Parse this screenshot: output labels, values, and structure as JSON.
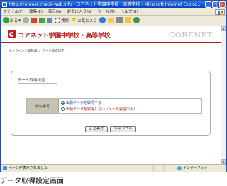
{
  "window": {
    "title": "http://corenet.check-web.info - コアネット学園中学校・高等学校 - Microsoft Internet Explor..."
  },
  "menubar": {
    "items": [
      "ファイル(F)",
      "編集(E)",
      "表示(V)",
      "お気に入り(A)",
      "ツール(T)",
      "ヘルプ(H)"
    ]
  },
  "toolbar": {
    "back_label": "戻る",
    "search_label": "検索",
    "favorites_label": "お気に入り"
  },
  "header": {
    "school_name": "コアネット学園中学校・高等学校",
    "brand": "CORENET"
  },
  "breadcrumb": "オンライン出願管理 > データ取得設定",
  "panel": {
    "title": "データ取得設定",
    "row_label": "受付番号",
    "options": [
      {
        "label": "出願データを取得する",
        "selected": true
      },
      {
        "label": "出願データを取得しない（メール受信のみ）",
        "selected": false
      }
    ],
    "confirm_button": "訂正実行",
    "cancel_button": "キャンセル"
  },
  "status": {
    "left": "ページが表示されました",
    "right": "インターネット"
  },
  "caption": "データ取得設定画面",
  "colors": {
    "accent": "#b51e1a",
    "titlebar": "#0a4fd1",
    "option_selected": "#1a3fa0",
    "option_other": "#b21e1e"
  }
}
